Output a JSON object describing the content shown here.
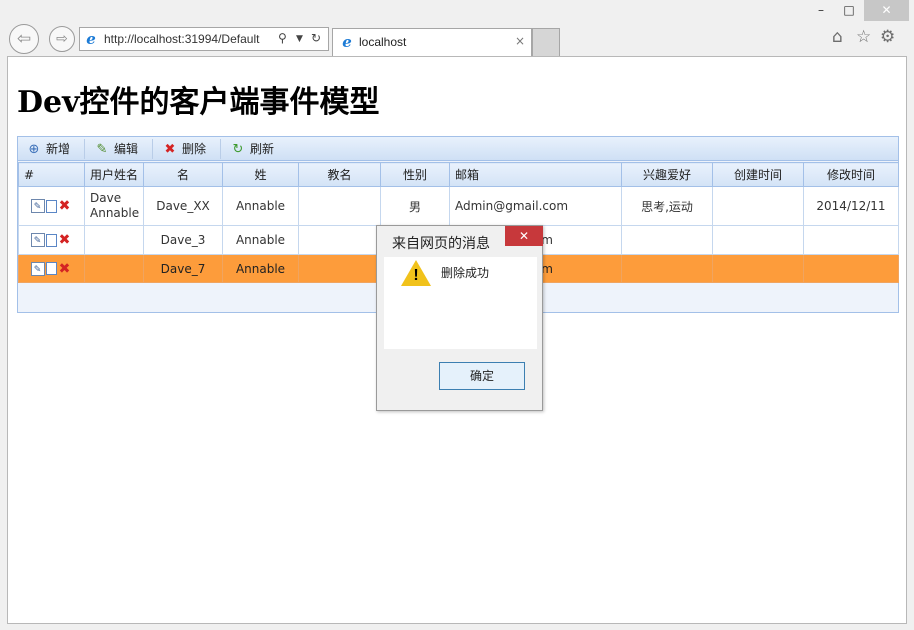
{
  "window": {
    "minimize": "–",
    "maximize": "□",
    "close": "✕"
  },
  "browser": {
    "back_icon": "arrow-left",
    "forward_icon": "arrow-right",
    "address": "http://localhost:31994/Default",
    "tab_title": "localhost",
    "tab_close": "×"
  },
  "page": {
    "title": "Dev控件的客户端事件模型"
  },
  "toolbar": {
    "add_label": "新增",
    "edit_label": "编辑",
    "delete_label": "删除",
    "refresh_label": "刷新"
  },
  "table": {
    "columns": [
      "#",
      "用户姓名",
      "名",
      "姓",
      "教名",
      "性别",
      "邮箱",
      "兴趣爱好",
      "创建时间",
      "修改时间"
    ],
    "rows": [
      {
        "username": "Dave Annable",
        "first": "Dave_XX",
        "last": "Annable",
        "christian": "",
        "gender": "男",
        "email": "Admin@gmail.com",
        "hobby": "思考,运动",
        "created": "",
        "modified": "2014/12/11"
      },
      {
        "username": "",
        "first": "Dave_3",
        "last": "Annable",
        "christian": "",
        "gender": "",
        "email": "m",
        "hobby": "",
        "created": "",
        "modified": ""
      },
      {
        "username": "",
        "first": "Dave_7",
        "last": "Annable",
        "christian": "",
        "gender": "",
        "email": "m",
        "hobby": "",
        "created": "",
        "modified": ""
      }
    ]
  },
  "dialog": {
    "title": "来自网页的消息",
    "close": "✕",
    "message": "删除成功",
    "ok_label": "确定"
  },
  "colors": {
    "selected_row": "#fd9c3b",
    "grid_header": "#d3e3f6",
    "dialog_close": "#c7383b"
  }
}
